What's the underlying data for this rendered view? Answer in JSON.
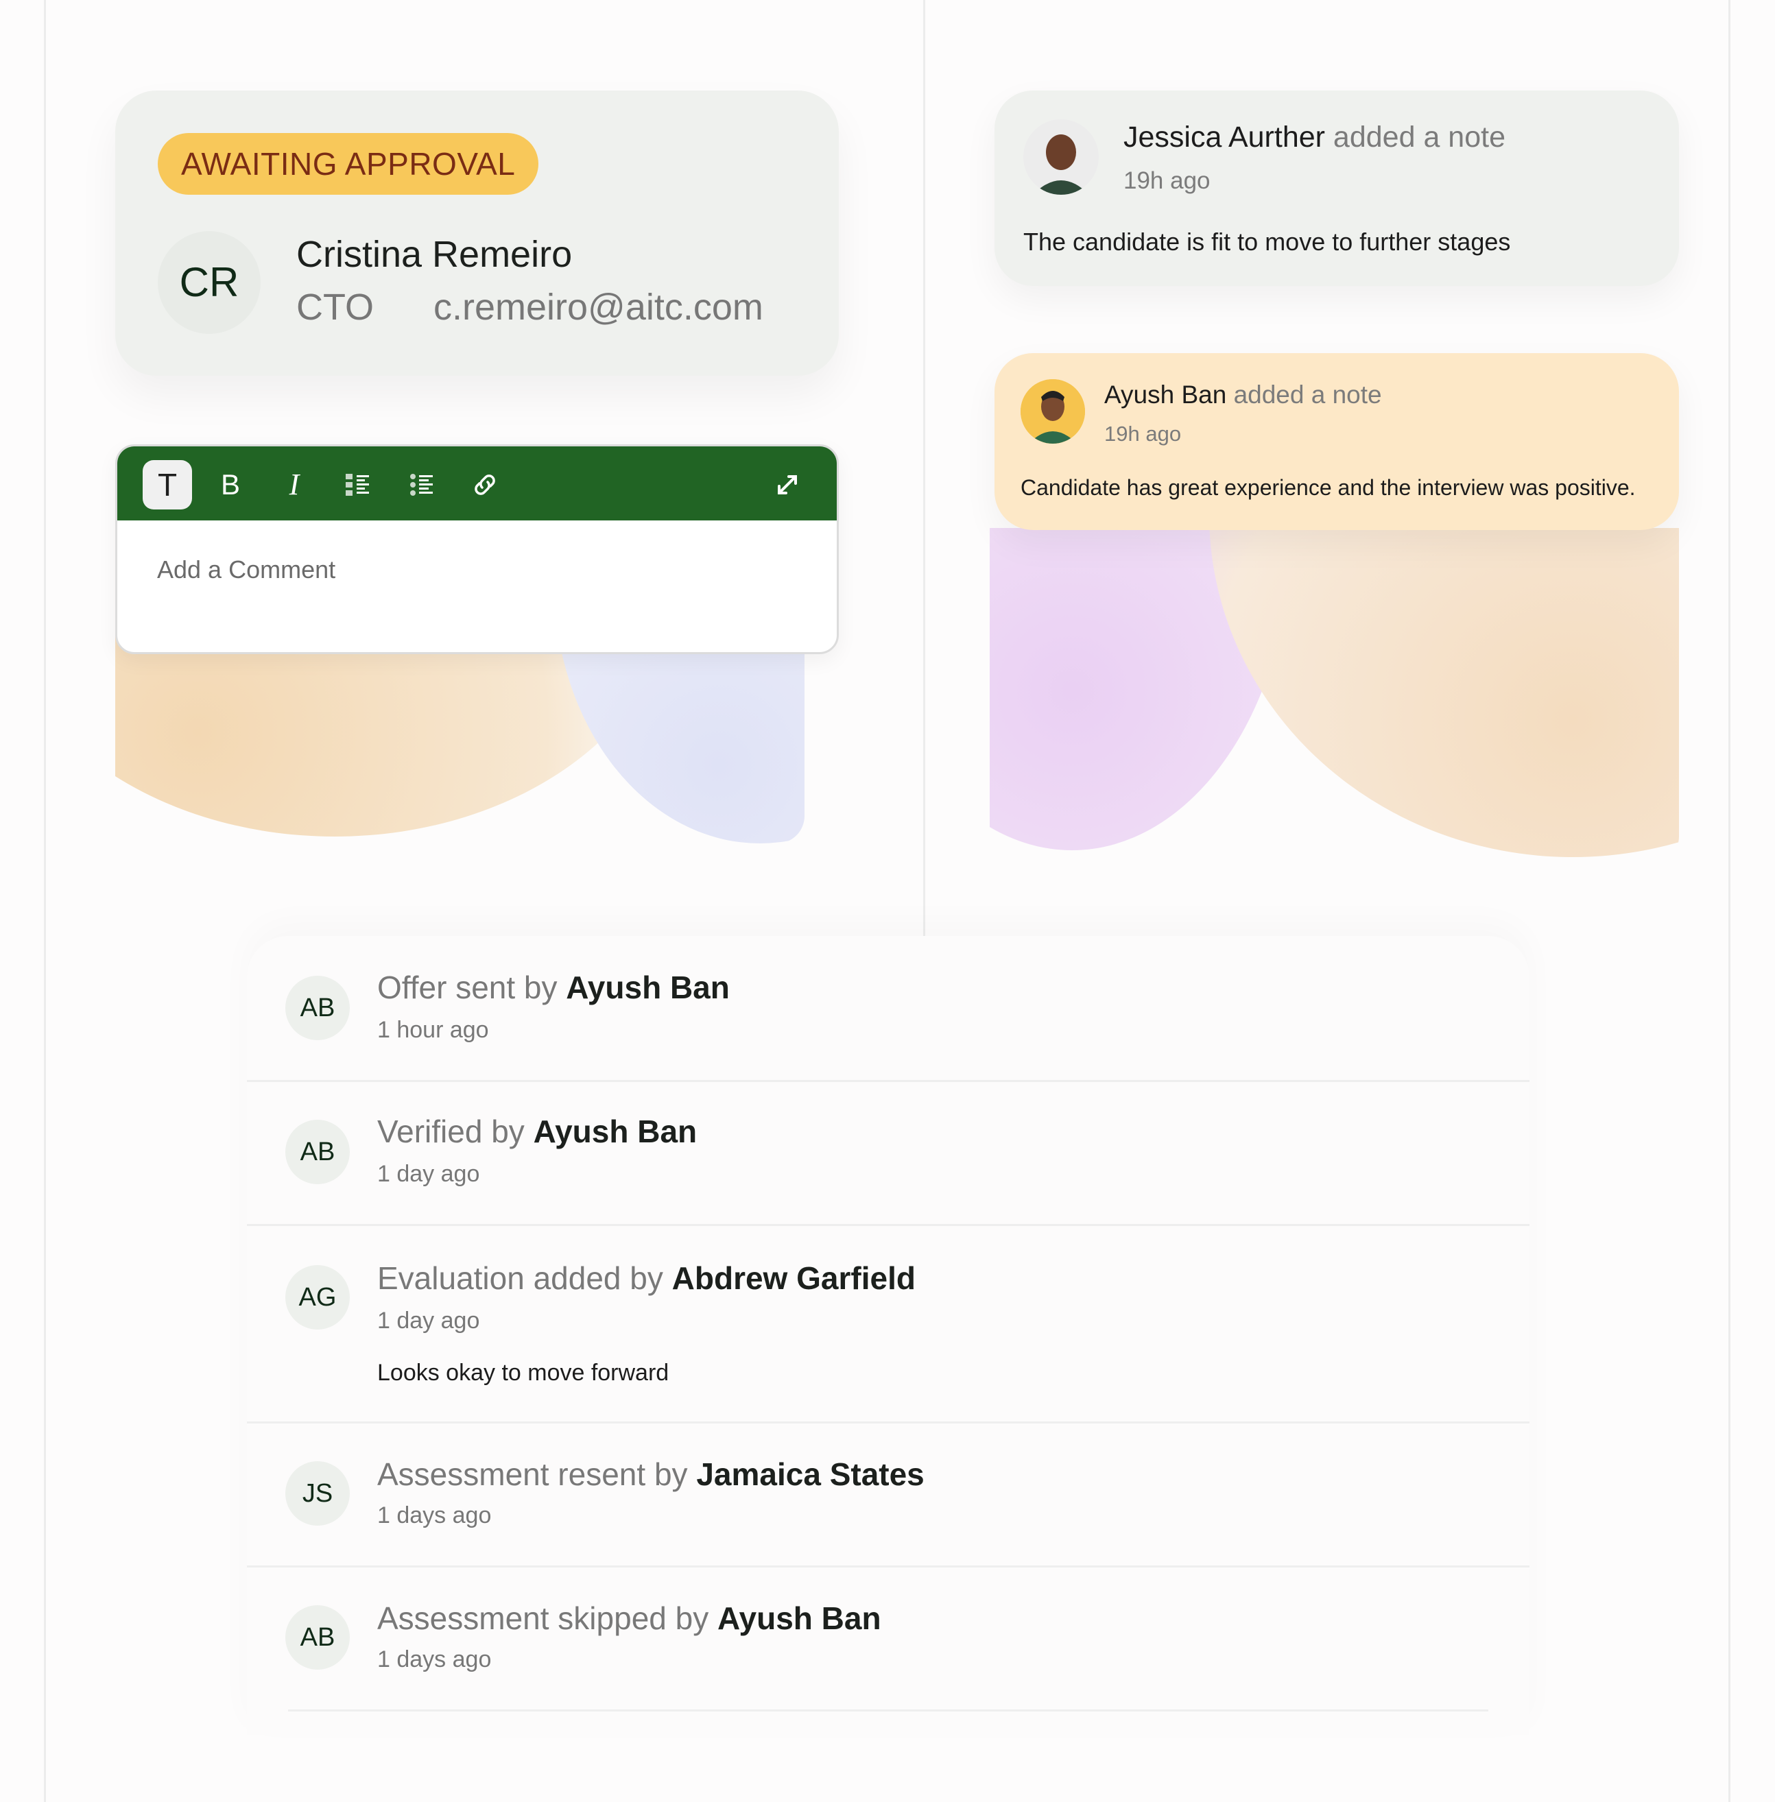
{
  "approval_card": {
    "status": "AWAITING APPROVAL",
    "avatar_initials": "CR",
    "name": "Cristina Remeiro",
    "role": "CTO",
    "email": "c.remeiro@aitc.com"
  },
  "editor": {
    "toolbar": {
      "text_style": "T",
      "bold": "B",
      "italic": "I",
      "bullet_list_icon": "bullet-list-icon",
      "numbered_list_icon": "numbered-list-icon",
      "link_icon": "link-icon",
      "expand_icon": "expand-icon"
    },
    "placeholder": "Add a Comment",
    "toolbar_color": "#216424"
  },
  "notes": [
    {
      "author": "Jessica Aurther",
      "action": "added a note",
      "time": "19h ago",
      "body": "The candidate is fit to move to further stages"
    },
    {
      "author": "Ayush Ban",
      "action": "added a note",
      "time": "19h ago",
      "body": "Candidate has great experience and the interview was positive."
    }
  ],
  "activity": [
    {
      "initials": "AB",
      "action": "Offer sent by",
      "actor": "Ayush Ban",
      "time": "1 hour ago"
    },
    {
      "initials": "AB",
      "action": "Verified by",
      "actor": "Ayush Ban",
      "time": "1 day ago"
    },
    {
      "initials": "AG",
      "action": "Evaluation added by",
      "actor": "Abdrew Garfield",
      "time": "1 day ago",
      "note": "Looks okay to move forward"
    },
    {
      "initials": "JS",
      "action": "Assessment resent by",
      "actor": "Jamaica States",
      "time": "1 days ago"
    },
    {
      "initials": "AB",
      "action": "Assessment skipped by",
      "actor": "Ayush Ban",
      "time": "1 days ago"
    }
  ],
  "colors": {
    "badge_bg": "#f8c85a",
    "badge_text": "#7a2c14",
    "card_bg": "#eff1ee",
    "note_highlight_bg": "#fde8c7"
  }
}
